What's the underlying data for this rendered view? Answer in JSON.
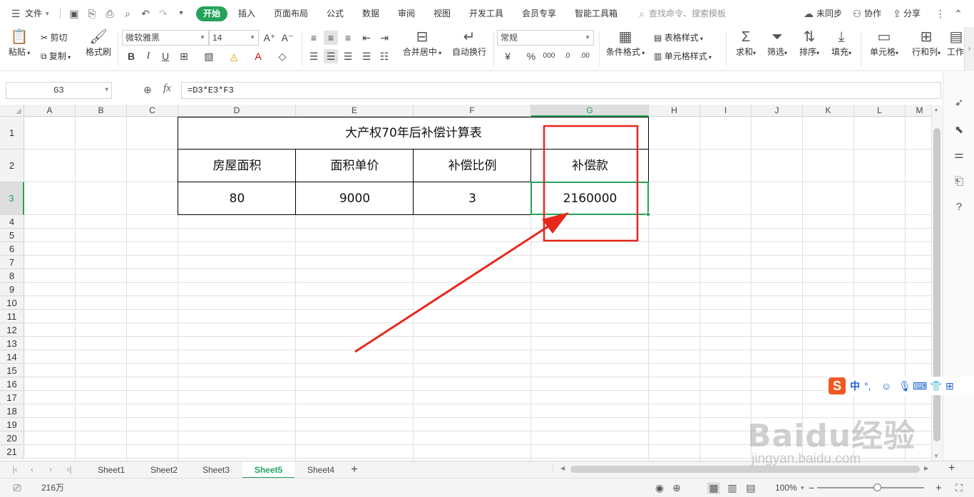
{
  "menubar": {
    "file_label": "文件",
    "tabs": [
      "开始",
      "插入",
      "页面布局",
      "公式",
      "数据",
      "审阅",
      "视图",
      "开发工具",
      "会员专享",
      "智能工具箱"
    ],
    "search_placeholder": "查找命令、搜索模板",
    "sync_label": "未同步",
    "collab_label": "协作",
    "share_label": "分享"
  },
  "ribbon": {
    "paste": "粘贴",
    "cut": "剪切",
    "copy": "复制",
    "format_painter": "格式刷",
    "font_name": "微软雅黑",
    "font_size": "14",
    "merge_center": "合并居中",
    "wrap_text": "自动换行",
    "number_format": "常规",
    "conditional_format": "条件格式",
    "table_style": "表格样式",
    "cell_style": "单元格样式",
    "sum": "求和",
    "filter": "筛选",
    "sort": "排序",
    "fill": "填充",
    "cell": "单元格",
    "rows_cols": "行和列",
    "worksheet": "工作"
  },
  "formula_bar": {
    "cell_ref": "G3",
    "fx": "fx",
    "formula": "=D3*E3*F3"
  },
  "grid": {
    "columns": [
      "A",
      "B",
      "C",
      "D",
      "E",
      "F",
      "G",
      "H",
      "I",
      "J",
      "K",
      "L",
      "M"
    ],
    "rows": [
      "1",
      "2",
      "3",
      "4",
      "5",
      "6",
      "7",
      "8",
      "9",
      "10",
      "11",
      "12",
      "13",
      "14",
      "15",
      "16",
      "17",
      "18",
      "19",
      "20",
      "21"
    ],
    "selected_column": "G",
    "selected_row": "3"
  },
  "table": {
    "title": "大产权70年后补偿计算表",
    "headers": [
      "房屋面积",
      "面积单价",
      "补偿比例",
      "补偿款"
    ],
    "values": [
      "80",
      "9000",
      "3",
      "2160000"
    ]
  },
  "sheets": {
    "tabs": [
      "Sheet1",
      "Sheet2",
      "Sheet3",
      "Sheet5",
      "Sheet4"
    ],
    "active": "Sheet5",
    "add": "+"
  },
  "status": {
    "sum_value": "216万",
    "zoom": "100%"
  },
  "ime": {
    "logo": "S",
    "mode": "中",
    "punct": "°,"
  },
  "watermark": {
    "brand": "Baidu经验",
    "url": "jingyan.baidu.com"
  },
  "colors": {
    "accent_green": "#23a35a",
    "annotation_red": "#e8271c",
    "ime_orange": "#f05a22"
  }
}
